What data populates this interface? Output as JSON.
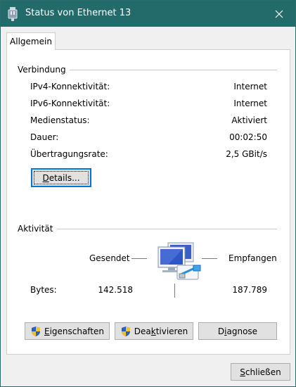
{
  "window": {
    "title": "Status von Ethernet 13",
    "title_icon": "network-adapter-icon",
    "close_icon": "close-icon"
  },
  "tabs": [
    {
      "label": "Allgemein",
      "selected": true
    }
  ],
  "connection": {
    "group_label": "Verbindung",
    "rows": [
      {
        "label": "IPv4-Konnektivität:",
        "value": "Internet"
      },
      {
        "label": "IPv6-Konnektivität:",
        "value": "Internet"
      },
      {
        "label": "Medienstatus:",
        "value": "Aktiviert"
      },
      {
        "label": "Dauer:",
        "value": "00:02:50"
      },
      {
        "label": "Übertragungsrate:",
        "value": "2,5 GBit/s"
      }
    ],
    "details_button": {
      "pre": "",
      "key": "D",
      "post": "etails..."
    }
  },
  "activity": {
    "group_label": "Aktivität",
    "sent_label": "Gesendet",
    "received_label": "Empfangen",
    "bytes_label": "Bytes:",
    "bytes_sent": "142.518",
    "bytes_received": "187.789",
    "icon": "network-computers-icon"
  },
  "actions": {
    "properties": {
      "pre": "",
      "key": "E",
      "post": "igenschaften",
      "icon": "uac-shield-icon"
    },
    "disable": {
      "pre": "Dea",
      "key": "k",
      "post": "tivieren",
      "icon": "uac-shield-icon"
    },
    "diagnose": {
      "pre": "D",
      "key": "i",
      "post": "agnose"
    }
  },
  "footer": {
    "close_button": {
      "pre": "",
      "key": "S",
      "post": "chließen"
    }
  },
  "colors": {
    "titlebar": "#236b6b",
    "focus": "#0078d7",
    "shield_blue": "#2a5fc4",
    "shield_yellow": "#f2c12e"
  }
}
